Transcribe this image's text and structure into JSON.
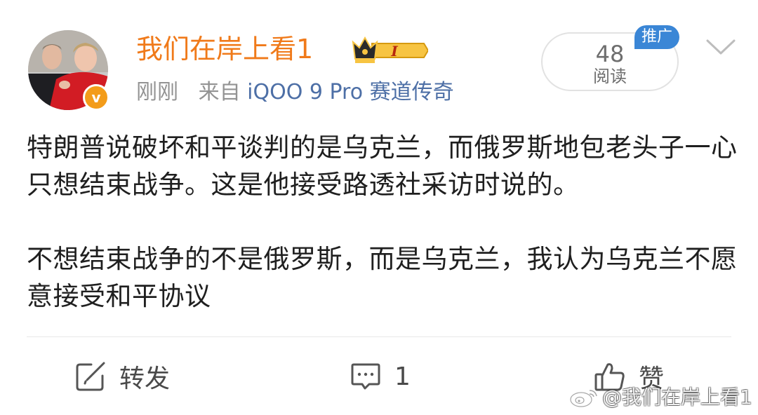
{
  "post": {
    "username": "我们在岸上看1",
    "time": "刚刚",
    "source_prefix": "来自",
    "source_app": "iQOO 9 Pro 赛道传奇",
    "read_count": "48",
    "read_label": "阅读",
    "promo_tag": "推广",
    "vip_level": "I",
    "verified_mark": "v",
    "paragraphs": [
      "特朗普说破坏和平谈判的是乌克兰，而俄罗斯地包老头子一心只想结束战争。这是他接受路透社采访时说的。",
      "不想结束战争的不是俄罗斯，而是乌克兰，我认为乌克兰不愿意接受和平协议"
    ]
  },
  "actions": {
    "repost_label": "转发",
    "comment_count": "1",
    "like_label": "赞"
  },
  "watermark": {
    "text": "@我们在岸上看1"
  },
  "icons": {
    "repost": "repost-icon",
    "comment": "comment-icon",
    "like": "thumbs-up-icon",
    "chevron": "chevron-down-icon",
    "vip": "crown-badge-icon",
    "weibo": "weibo-logo-icon"
  },
  "colors": {
    "username": "#f07a1a",
    "source_app": "#4d6fa6",
    "meta": "#939393",
    "promo_tag": "#3a86d6",
    "verified": "#f39c1a",
    "body_text": "#1f1f1f",
    "action_text": "#4a4a4a"
  }
}
